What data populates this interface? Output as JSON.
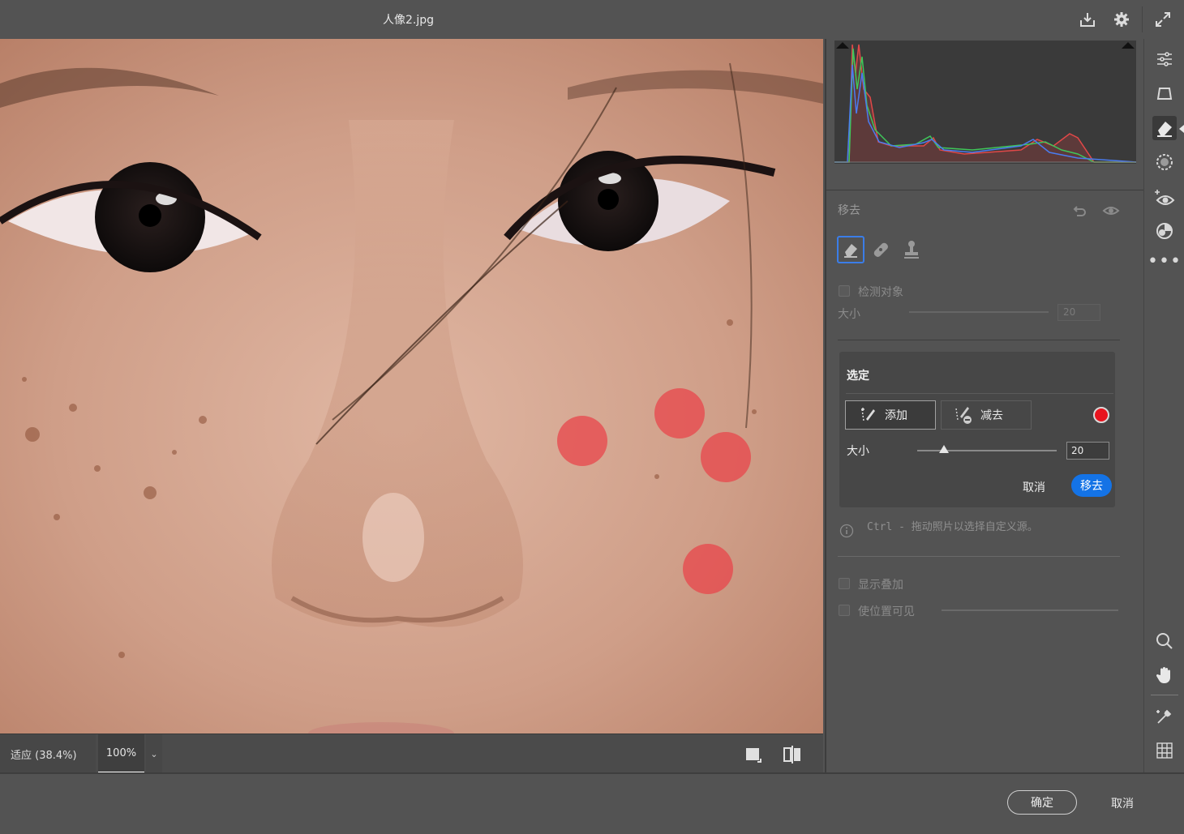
{
  "window": {
    "title": "人像2.jpg"
  },
  "statusbar": {
    "zoom_fit": "适应 (38.4%)",
    "zoom_value": "100%"
  },
  "remove_section": {
    "heading": "移去",
    "detect_objects_label": "检测对象",
    "size_label": "大小",
    "size_value": "20"
  },
  "selection": {
    "heading": "选定",
    "add_label": "添加",
    "subtract_label": "减去",
    "size_label": "大小",
    "size_value": "20",
    "size_fraction": 0.19,
    "color": "#e8141e",
    "cancel_label": "取消",
    "apply_label": "移去"
  },
  "hint": {
    "text": "Ctrl - 拖动照片以选择自定义源。"
  },
  "overlay": {
    "show_overlay_label": "显示叠加",
    "show_positions_label": "使位置可见"
  },
  "footer": {
    "ok_label": "确定",
    "cancel_label": "取消"
  },
  "colors": {
    "accent": "#1473e6",
    "spot": "#e8464b",
    "background": "#535353"
  },
  "icons": {
    "titlebar": [
      "download-icon",
      "gear-icon",
      "expand-icon"
    ],
    "toolstrip": [
      "sliders-icon",
      "crop-icon",
      "eraser-icon",
      "mask-icon",
      "red-eye-icon",
      "presets-icon",
      "more-icon",
      "zoom-icon",
      "hand-icon",
      "eyedropper-icon",
      "grid-icon"
    ]
  }
}
